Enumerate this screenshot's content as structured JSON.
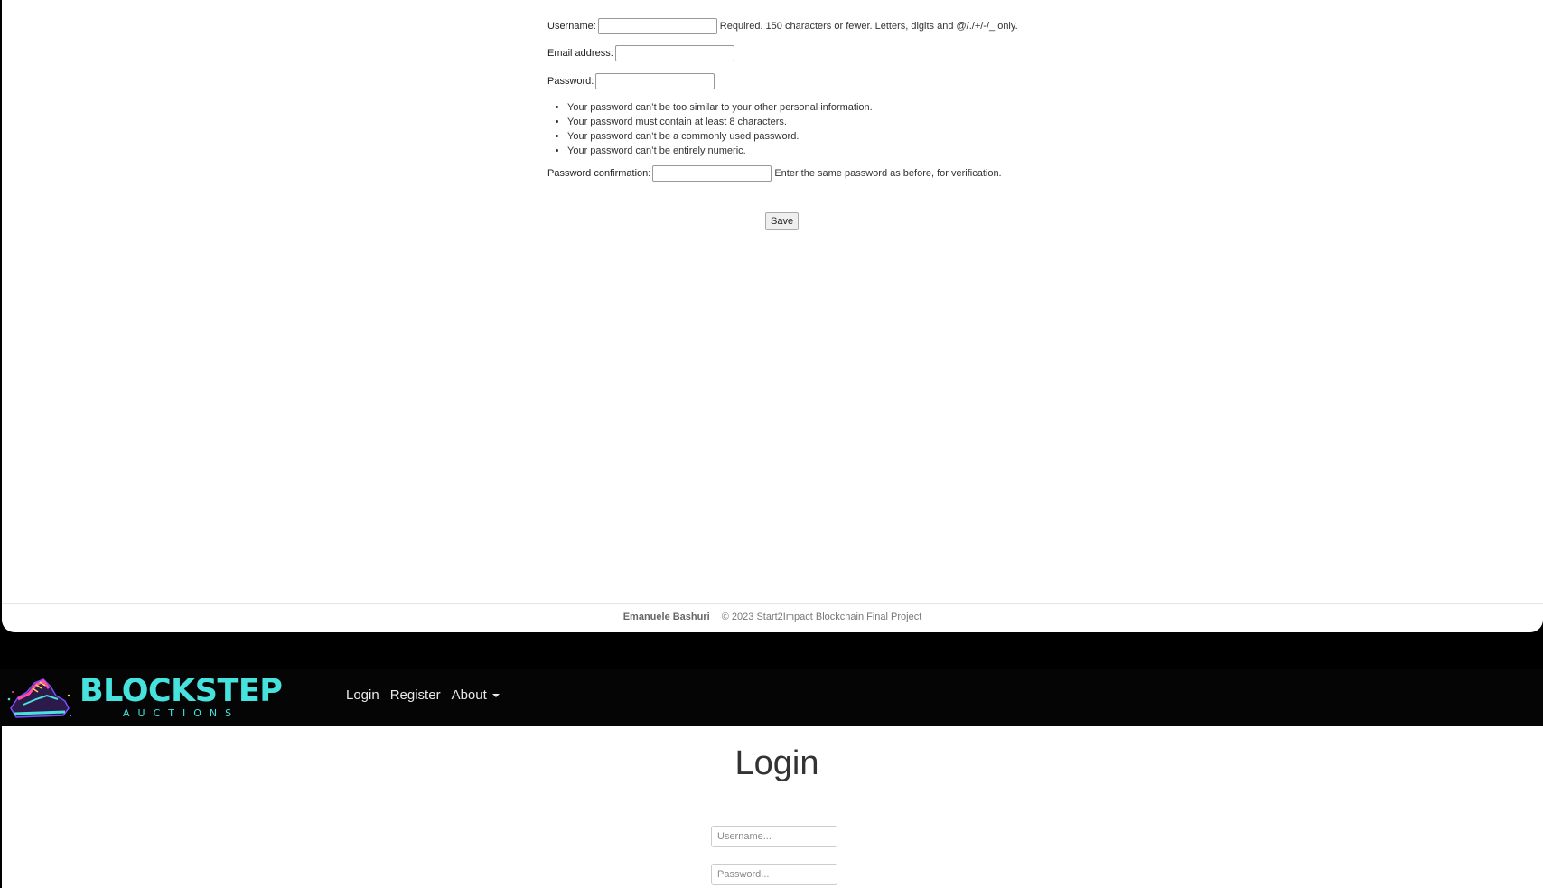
{
  "register_form": {
    "username_label": "Username:",
    "username_value": "",
    "username_help": "Required. 150 characters or fewer. Letters, digits and @/./+/-/_ only.",
    "email_label": "Email address:",
    "email_value": "",
    "password_label": "Password:",
    "password_value": "",
    "password_rules": [
      "Your password can’t be too similar to your other personal information.",
      "Your password must contain at least 8 characters.",
      "Your password can’t be a commonly used password.",
      "Your password can’t be entirely numeric."
    ],
    "confirm_label": "Password confirmation:",
    "confirm_value": "",
    "confirm_help": "Enter the same password as before, for verification.",
    "save_label": "Save"
  },
  "footer": {
    "author": "Emanuele Bashuri",
    "copyright": "© 2023 Start2Impact Blockchain Final Project"
  },
  "navbar": {
    "brand_name": "BLOCKSTEP",
    "brand_sub": "AUCTIONS",
    "links": [
      "Login",
      "Register",
      "About"
    ]
  },
  "login": {
    "title": "Login",
    "username_placeholder": "Username...",
    "password_placeholder": "Password..."
  },
  "colors": {
    "brand": "#46e3de",
    "navbar_bg": "#050505",
    "page_bg": "#ffffff"
  }
}
